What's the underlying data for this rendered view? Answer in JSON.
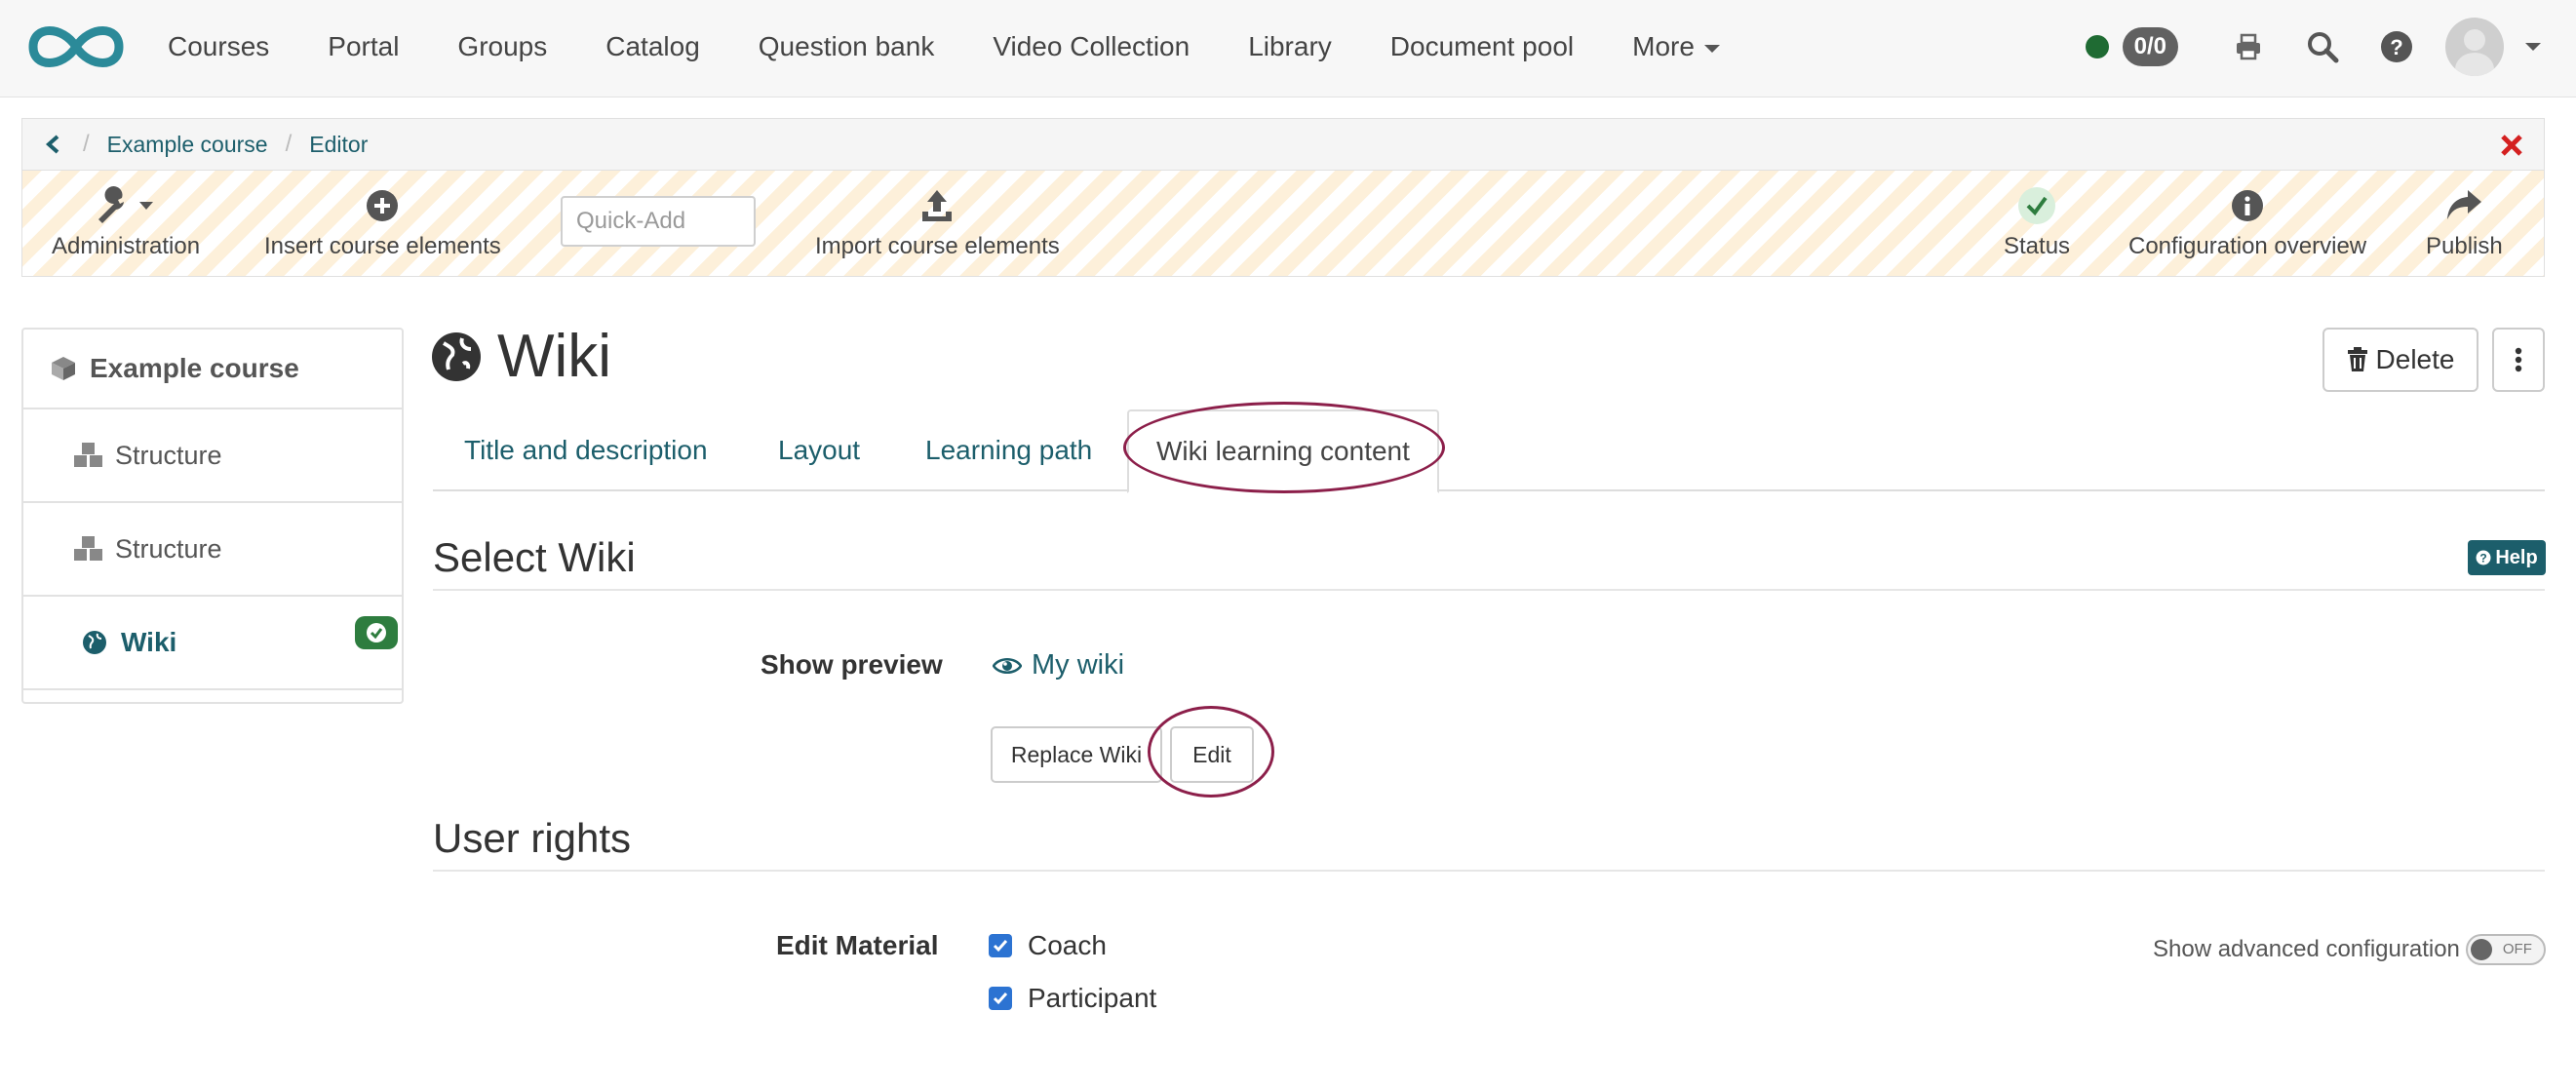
{
  "nav": {
    "links": [
      "Courses",
      "Portal",
      "Groups",
      "Catalog",
      "Question bank",
      "Video Collection",
      "Library",
      "Document pool",
      "More"
    ],
    "count_badge": "0/0"
  },
  "breadcrumb": {
    "items": [
      "Example course",
      "Editor"
    ]
  },
  "toolbar": {
    "administration": "Administration",
    "insert": "Insert course elements",
    "quickadd_placeholder": "Quick-Add",
    "import": "Import course elements",
    "status": "Status",
    "config_overview": "Configuration overview",
    "publish": "Publish"
  },
  "sidebar": {
    "course": "Example course",
    "items": [
      "Structure",
      "Structure",
      "Wiki"
    ]
  },
  "main": {
    "title": "Wiki",
    "delete_label": "Delete",
    "tabs": [
      "Title and description",
      "Layout",
      "Learning path",
      "Wiki learning content"
    ],
    "select_wiki": {
      "heading": "Select Wiki",
      "help": "Help",
      "preview_label": "Show preview",
      "preview_link": "My wiki",
      "replace_button": "Replace Wiki",
      "edit_button": "Edit"
    },
    "user_rights": {
      "heading": "User rights",
      "edit_material_label": "Edit Material",
      "options": [
        {
          "label": "Coach",
          "checked": true
        },
        {
          "label": "Participant",
          "checked": true
        }
      ],
      "advanced_label": "Show advanced configuration",
      "toggle_state": "OFF"
    }
  },
  "colors": {
    "accent": "#1c5e6b",
    "annotation": "#8c1f4a",
    "success": "#2e7d3f",
    "checkbox": "#2c73d2"
  }
}
